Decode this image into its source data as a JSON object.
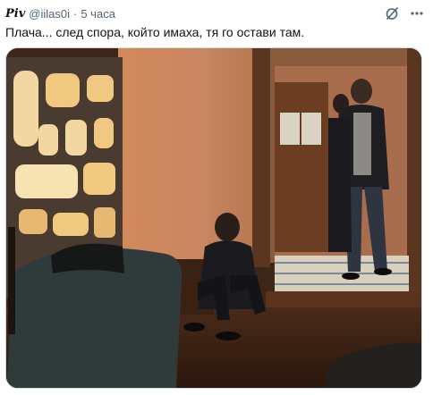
{
  "post": {
    "display_name": "Piv",
    "handle": "@iilas0i",
    "separator": "·",
    "time": "5 часа",
    "text": "Плача... след спора, който имаха, тя го остави там."
  },
  "icons": {
    "grok": "grok-icon",
    "more": "more-icon"
  },
  "colors": {
    "text_primary": "#0f1419",
    "text_secondary": "#536471",
    "border": "#cfd9de"
  }
}
